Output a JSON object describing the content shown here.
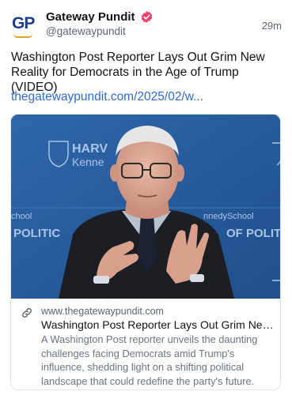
{
  "author": {
    "name": "Gateway Pundit",
    "handle": "@gatewaypundit",
    "avatar_text": "GP",
    "verified_color": "#ef3f6b"
  },
  "post": {
    "time": "29m",
    "text": "Washington Post Reporter Lays Out Grim New Reality for Democrats in the Age of Trump (VIDEO)",
    "link_text": "thegatewaypundit.com/2025/02/w..."
  },
  "card": {
    "image_signs": {
      "top_left": "HARV",
      "top_left_sub": "Kenne",
      "left_small": "chool",
      "left_big": "POLITIC",
      "right_small": "nnedySchool",
      "right_big": "OF POLIT"
    },
    "domain": "www.thegatewaypundit.com",
    "title": "Washington Post Reporter Lays Out Grim New ...",
    "description": "A Washington Post reporter unveils the daunting challenges facing Democrats amid Trump's influence, shedding light on a shifting political landscape that could redefine the party's future."
  },
  "colors": {
    "link": "#2f6bd6",
    "backdrop": "#2a5d9f"
  },
  "icons": {
    "verified": "verified-badge-icon",
    "link": "link-icon"
  }
}
